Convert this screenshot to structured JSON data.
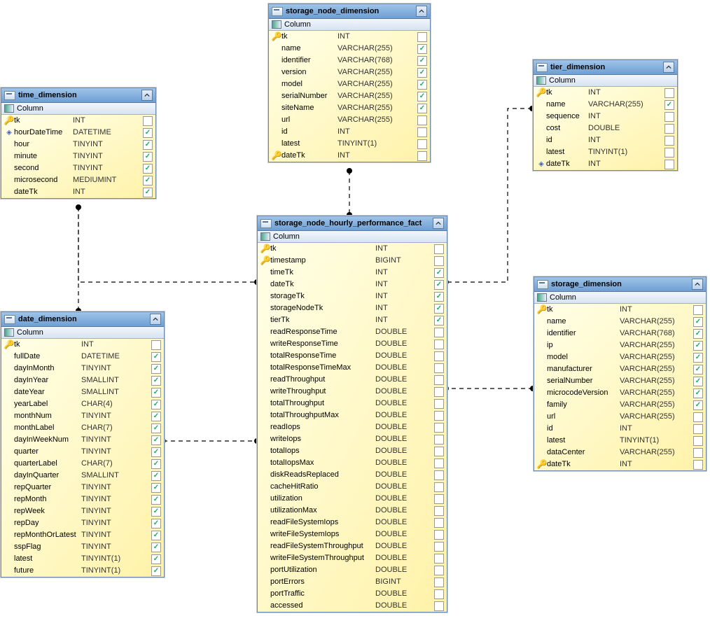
{
  "col_label": "Column",
  "tables": {
    "time": {
      "title": "time_dimension",
      "cols": [
        {
          "k": "pk",
          "n": "tk",
          "t": "INT",
          "c": 0,
          "w": 84
        },
        {
          "k": "d",
          "n": "hourDateTime",
          "t": "DATETIME",
          "c": 1,
          "w": 84
        },
        {
          "k": "",
          "n": "hour",
          "t": "TINYINT",
          "c": 1,
          "w": 84
        },
        {
          "k": "",
          "n": "minute",
          "t": "TINYINT",
          "c": 1,
          "w": 84
        },
        {
          "k": "",
          "n": "second",
          "t": "TINYINT",
          "c": 1,
          "w": 84
        },
        {
          "k": "",
          "n": "microsecond",
          "t": "MEDIUMINT",
          "c": 1,
          "w": 84
        },
        {
          "k": "",
          "n": "dateTk",
          "t": "INT",
          "c": 1,
          "w": 84
        }
      ]
    },
    "storage_node": {
      "title": "storage_node_dimension",
      "cols": [
        {
          "k": "pk",
          "n": "tk",
          "t": "INT",
          "c": 0,
          "w": 80
        },
        {
          "k": "",
          "n": "name",
          "t": "VARCHAR(255)",
          "c": 1,
          "w": 80
        },
        {
          "k": "",
          "n": "identifier",
          "t": "VARCHAR(768)",
          "c": 1,
          "w": 80
        },
        {
          "k": "",
          "n": "version",
          "t": "VARCHAR(255)",
          "c": 1,
          "w": 80
        },
        {
          "k": "",
          "n": "model",
          "t": "VARCHAR(255)",
          "c": 1,
          "w": 80
        },
        {
          "k": "",
          "n": "serialNumber",
          "t": "VARCHAR(255)",
          "c": 1,
          "w": 80
        },
        {
          "k": "",
          "n": "siteName",
          "t": "VARCHAR(255)",
          "c": 1,
          "w": 80
        },
        {
          "k": "",
          "n": "url",
          "t": "VARCHAR(255)",
          "c": 0,
          "w": 80
        },
        {
          "k": "",
          "n": "id",
          "t": "INT",
          "c": 0,
          "w": 80
        },
        {
          "k": "",
          "n": "latest",
          "t": "TINYINT(1)",
          "c": 0,
          "w": 80
        },
        {
          "k": "pk",
          "n": "dateTk",
          "t": "INT",
          "c": 0,
          "w": 80
        }
      ]
    },
    "tier": {
      "title": "tier_dimension",
      "cols": [
        {
          "k": "pk",
          "n": "tk",
          "t": "INT",
          "c": 0,
          "w": 60
        },
        {
          "k": "",
          "n": "name",
          "t": "VARCHAR(255)",
          "c": 1,
          "w": 60
        },
        {
          "k": "",
          "n": "sequence",
          "t": "INT",
          "c": 0,
          "w": 60
        },
        {
          "k": "",
          "n": "cost",
          "t": "DOUBLE",
          "c": 0,
          "w": 60
        },
        {
          "k": "",
          "n": "id",
          "t": "INT",
          "c": 0,
          "w": 60
        },
        {
          "k": "",
          "n": "latest",
          "t": "TINYINT(1)",
          "c": 0,
          "w": 60
        },
        {
          "k": "d",
          "n": "dateTk",
          "t": "INT",
          "c": 0,
          "w": 60
        }
      ]
    },
    "fact": {
      "title": "storage_node_hourly_performance_fact",
      "cols": [
        {
          "k": "pk",
          "n": "tk",
          "t": "INT",
          "c": 0,
          "w": 150
        },
        {
          "k": "pk",
          "n": "timestamp",
          "t": "BIGINT",
          "c": 0,
          "w": 150
        },
        {
          "k": "",
          "n": "timeTk",
          "t": "INT",
          "c": 1,
          "w": 150
        },
        {
          "k": "",
          "n": "dateTk",
          "t": "INT",
          "c": 1,
          "w": 150
        },
        {
          "k": "",
          "n": "storageTk",
          "t": "INT",
          "c": 1,
          "w": 150
        },
        {
          "k": "",
          "n": "storageNodeTk",
          "t": "INT",
          "c": 1,
          "w": 150
        },
        {
          "k": "",
          "n": "tierTk",
          "t": "INT",
          "c": 1,
          "w": 150
        },
        {
          "k": "",
          "n": "readResponseTime",
          "t": "DOUBLE",
          "c": 0,
          "w": 150
        },
        {
          "k": "",
          "n": "writeResponseTime",
          "t": "DOUBLE",
          "c": 0,
          "w": 150
        },
        {
          "k": "",
          "n": "totalResponseTime",
          "t": "DOUBLE",
          "c": 0,
          "w": 150
        },
        {
          "k": "",
          "n": "totalResponseTimeMax",
          "t": "DOUBLE",
          "c": 0,
          "w": 150
        },
        {
          "k": "",
          "n": "readThroughput",
          "t": "DOUBLE",
          "c": 0,
          "w": 150
        },
        {
          "k": "",
          "n": "writeThroughput",
          "t": "DOUBLE",
          "c": 0,
          "w": 150
        },
        {
          "k": "",
          "n": "totalThroughput",
          "t": "DOUBLE",
          "c": 0,
          "w": 150
        },
        {
          "k": "",
          "n": "totalThroughputMax",
          "t": "DOUBLE",
          "c": 0,
          "w": 150
        },
        {
          "k": "",
          "n": "readIops",
          "t": "DOUBLE",
          "c": 0,
          "w": 150
        },
        {
          "k": "",
          "n": "writeIops",
          "t": "DOUBLE",
          "c": 0,
          "w": 150
        },
        {
          "k": "",
          "n": "totalIops",
          "t": "DOUBLE",
          "c": 0,
          "w": 150
        },
        {
          "k": "",
          "n": "totalIopsMax",
          "t": "DOUBLE",
          "c": 0,
          "w": 150
        },
        {
          "k": "",
          "n": "diskReadsReplaced",
          "t": "DOUBLE",
          "c": 0,
          "w": 150
        },
        {
          "k": "",
          "n": "cacheHitRatio",
          "t": "DOUBLE",
          "c": 0,
          "w": 150
        },
        {
          "k": "",
          "n": "utilization",
          "t": "DOUBLE",
          "c": 0,
          "w": 150
        },
        {
          "k": "",
          "n": "utilizationMax",
          "t": "DOUBLE",
          "c": 0,
          "w": 150
        },
        {
          "k": "",
          "n": "readFileSystemIops",
          "t": "DOUBLE",
          "c": 0,
          "w": 150
        },
        {
          "k": "",
          "n": "writeFileSystemIops",
          "t": "DOUBLE",
          "c": 0,
          "w": 150
        },
        {
          "k": "",
          "n": "readFileSystemThroughput",
          "t": "DOUBLE",
          "c": 0,
          "w": 150
        },
        {
          "k": "",
          "n": "writeFileSystemThroughput",
          "t": "DOUBLE",
          "c": 0,
          "w": 150
        },
        {
          "k": "",
          "n": "portUtilization",
          "t": "DOUBLE",
          "c": 0,
          "w": 150
        },
        {
          "k": "",
          "n": "portErrors",
          "t": "BIGINT",
          "c": 0,
          "w": 150
        },
        {
          "k": "",
          "n": "portTraffic",
          "t": "DOUBLE",
          "c": 0,
          "w": 150
        },
        {
          "k": "",
          "n": "accessed",
          "t": "DOUBLE",
          "c": 0,
          "w": 150
        }
      ]
    },
    "date": {
      "title": "date_dimension",
      "cols": [
        {
          "k": "pk",
          "n": "tk",
          "t": "INT",
          "c": 0,
          "w": 96
        },
        {
          "k": "",
          "n": "fullDate",
          "t": "DATETIME",
          "c": 1,
          "w": 96
        },
        {
          "k": "",
          "n": "dayInMonth",
          "t": "TINYINT",
          "c": 1,
          "w": 96
        },
        {
          "k": "",
          "n": "dayInYear",
          "t": "SMALLINT",
          "c": 1,
          "w": 96
        },
        {
          "k": "",
          "n": "dateYear",
          "t": "SMALLINT",
          "c": 1,
          "w": 96
        },
        {
          "k": "",
          "n": "yearLabel",
          "t": "CHAR(4)",
          "c": 1,
          "w": 96
        },
        {
          "k": "",
          "n": "monthNum",
          "t": "TINYINT",
          "c": 1,
          "w": 96
        },
        {
          "k": "",
          "n": "monthLabel",
          "t": "CHAR(7)",
          "c": 1,
          "w": 96
        },
        {
          "k": "",
          "n": "dayInWeekNum",
          "t": "TINYINT",
          "c": 1,
          "w": 96
        },
        {
          "k": "",
          "n": "quarter",
          "t": "TINYINT",
          "c": 1,
          "w": 96
        },
        {
          "k": "",
          "n": "quarterLabel",
          "t": "CHAR(7)",
          "c": 1,
          "w": 96
        },
        {
          "k": "",
          "n": "dayInQuarter",
          "t": "SMALLINT",
          "c": 1,
          "w": 96
        },
        {
          "k": "",
          "n": "repQuarter",
          "t": "TINYINT",
          "c": 1,
          "w": 96
        },
        {
          "k": "",
          "n": "repMonth",
          "t": "TINYINT",
          "c": 1,
          "w": 96
        },
        {
          "k": "",
          "n": "repWeek",
          "t": "TINYINT",
          "c": 1,
          "w": 96
        },
        {
          "k": "",
          "n": "repDay",
          "t": "TINYINT",
          "c": 1,
          "w": 96
        },
        {
          "k": "",
          "n": "repMonthOrLatest",
          "t": "TINYINT",
          "c": 1,
          "w": 96
        },
        {
          "k": "",
          "n": "sspFlag",
          "t": "TINYINT",
          "c": 1,
          "w": 96
        },
        {
          "k": "",
          "n": "latest",
          "t": "TINYINT(1)",
          "c": 1,
          "w": 96
        },
        {
          "k": "",
          "n": "future",
          "t": "TINYINT(1)",
          "c": 1,
          "w": 96
        }
      ]
    },
    "storage": {
      "title": "storage_dimension",
      "cols": [
        {
          "k": "pk",
          "n": "tk",
          "t": "INT",
          "c": 0,
          "w": 104
        },
        {
          "k": "",
          "n": "name",
          "t": "VARCHAR(255)",
          "c": 1,
          "w": 104
        },
        {
          "k": "",
          "n": "identifier",
          "t": "VARCHAR(768)",
          "c": 1,
          "w": 104
        },
        {
          "k": "",
          "n": "ip",
          "t": "VARCHAR(255)",
          "c": 1,
          "w": 104
        },
        {
          "k": "",
          "n": "model",
          "t": "VARCHAR(255)",
          "c": 1,
          "w": 104
        },
        {
          "k": "",
          "n": "manufacturer",
          "t": "VARCHAR(255)",
          "c": 1,
          "w": 104
        },
        {
          "k": "",
          "n": "serialNumber",
          "t": "VARCHAR(255)",
          "c": 1,
          "w": 104
        },
        {
          "k": "",
          "n": "microcodeVersion",
          "t": "VARCHAR(255)",
          "c": 1,
          "w": 104
        },
        {
          "k": "",
          "n": "family",
          "t": "VARCHAR(255)",
          "c": 1,
          "w": 104
        },
        {
          "k": "",
          "n": "url",
          "t": "VARCHAR(255)",
          "c": 0,
          "w": 104
        },
        {
          "k": "",
          "n": "id",
          "t": "INT",
          "c": 0,
          "w": 104
        },
        {
          "k": "",
          "n": "latest",
          "t": "TINYINT(1)",
          "c": 0,
          "w": 104
        },
        {
          "k": "",
          "n": "dataCenter",
          "t": "VARCHAR(255)",
          "c": 0,
          "w": 104
        },
        {
          "k": "pk",
          "n": "dateTk",
          "t": "INT",
          "c": 0,
          "w": 104
        }
      ]
    }
  }
}
